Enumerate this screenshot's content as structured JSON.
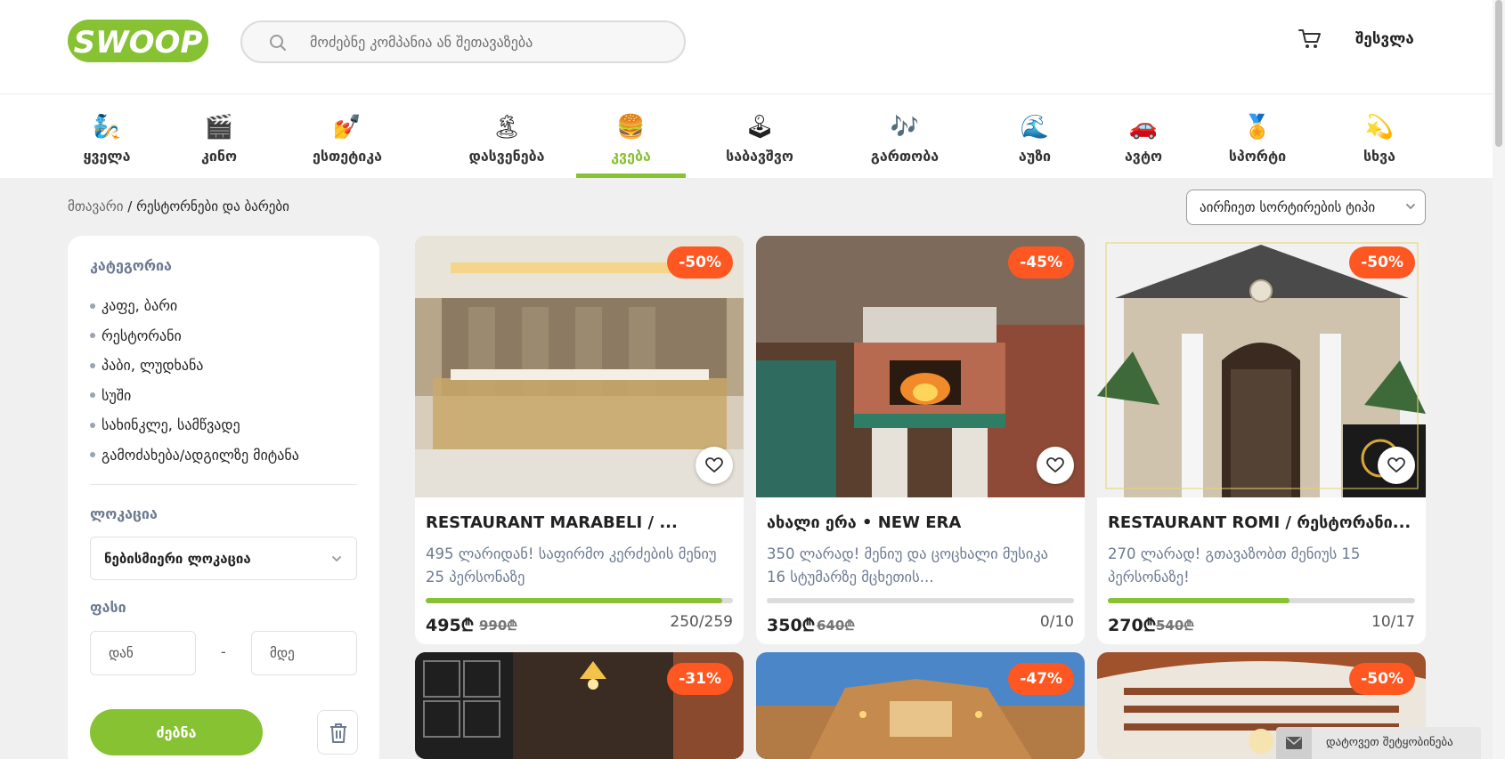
{
  "header": {
    "logo_text": "SWOOP",
    "search_placeholder": "მოძებნე კომპანია ან შეთავაზება",
    "login_label": "შესვლა"
  },
  "categories": [
    {
      "emoji": "🧞",
      "label": "ყველა",
      "active": false
    },
    {
      "emoji": "🎬",
      "label": "კინო",
      "active": false
    },
    {
      "emoji": "💅",
      "label": "ესთეტიკა",
      "active": false
    },
    {
      "emoji": "🏝",
      "label": "დასვენება",
      "active": false
    },
    {
      "emoji": "🍔",
      "label": "კვება",
      "active": true
    },
    {
      "emoji": "🕹",
      "label": "საბავშვო",
      "active": false
    },
    {
      "emoji": "🎶",
      "label": "გართობა",
      "active": false
    },
    {
      "emoji": "🌊",
      "label": "აუზი",
      "active": false
    },
    {
      "emoji": "🚗",
      "label": "ავტო",
      "active": false
    },
    {
      "emoji": "🏅",
      "label": "სპორტი",
      "active": false
    },
    {
      "emoji": "💫",
      "label": "სხვა",
      "active": false
    }
  ],
  "breadcrumb": {
    "home": "მთავარი",
    "separator": "/",
    "current": "რესტორნები და ბარები"
  },
  "sort": {
    "label": "აირჩიეთ სორტირების ტიპი"
  },
  "filters": {
    "category_title": "კატეგორია",
    "category_items": [
      "კაფე, ბარი",
      "რესტორანი",
      "პაბი, ლუდხანა",
      "სუში",
      "სახინკლე, სამწვადე",
      "გამოძახება/ადგილზე მიტანა"
    ],
    "location_title": "ლოკაცია",
    "location_value": "ნებისმიერი ლოკაცია",
    "price_title": "ფასი",
    "price_from_placeholder": "დან",
    "price_dash": "-",
    "price_to_placeholder": "მდე",
    "search_button": "ძებნა"
  },
  "offers": [
    {
      "discount": "-50%",
      "title": "RESTAURANT MARABELI / ...",
      "description": "495 ლარიდან! საფირმო კერძების მენიუ 25 პერსონაზე",
      "price": "495₾",
      "old_price": "990₾",
      "sold": "250/259",
      "progress": 0.965
    },
    {
      "discount": "-45%",
      "title": "ახალი ერა • NEW ERA",
      "description": "350 ლარად! მენიუ და ცოცხალი მუსიკა 16 სტუმარზე მცხეთის...",
      "price": "350₾",
      "old_price": "640₾",
      "sold": "0/10",
      "progress": 0.0
    },
    {
      "discount": "-50%",
      "title": "RESTAURANT ROMI / რესტორანი...",
      "description": "270 ლარად! გთავაზობთ მენიუს 15 პერსონაზე!",
      "price": "270₾",
      "old_price": "540₾",
      "sold": "10/17",
      "progress": 0.59
    }
  ],
  "offers_row2": [
    {
      "discount": "-31%"
    },
    {
      "discount": "-47%"
    },
    {
      "discount": "-50%"
    }
  ],
  "chat": {
    "label": "დატოვეთ შეტყობინება"
  },
  "colors": {
    "brand_green": "#86c232",
    "discount_orange": "#ff5722",
    "muted_text": "#6d7a91"
  }
}
